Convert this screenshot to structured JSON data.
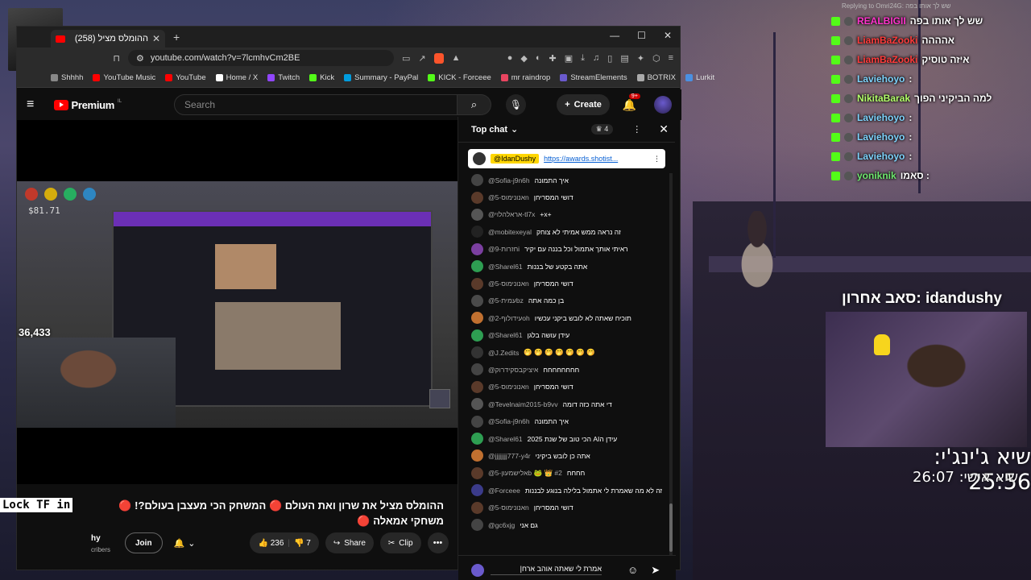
{
  "overlay": {
    "multiplier": "x4",
    "reply_to": "Replying to Omri24G: שש לך אותו בפה",
    "chat": [
      {
        "user": "REALBIGII",
        "user_color": "#ff33cc",
        "text": "שש לך אותו בפה",
        "badges": 3
      },
      {
        "user": "LiamBaZooki",
        "user_color": "#ff3b3b",
        "text": "אהההה"
      },
      {
        "user": "LiamBaZooki",
        "user_color": "#ff3b3b",
        "text": "איזה טוסיק"
      },
      {
        "user": "Laviehoyo",
        "user_color": "#7dd3fc",
        "text": ":"
      },
      {
        "user": "NikitaBarak",
        "user_color": "#b3ff6a",
        "text": "למה הביקיני הפוך"
      },
      {
        "user": "Laviehoyo",
        "user_color": "#7dd3fc",
        "text": ":"
      },
      {
        "user": "Laviehoyo",
        "user_color": "#7dd3fc",
        "text": ":"
      },
      {
        "user": "Laviehoyo",
        "user_color": "#7dd3fc",
        "text": ":"
      },
      {
        "user": "yoniknik",
        "user_color": "#6ee86e",
        "text": ": סאמו"
      }
    ],
    "cam_banner": "idandushy :סאב אחרון",
    "timer_main": "שיא ג'ינג'י: 25:56",
    "timer_personal": "שיא אישי: 26:07"
  },
  "browser": {
    "tab_title": "ההומלס מציל (258)",
    "url": "youtube.com/watch?v=7lcmhvCm2BE",
    "bookmarks": [
      {
        "label": "Shhhh",
        "color": "#888"
      },
      {
        "label": "YouTube Music",
        "color": "#ff0000"
      },
      {
        "label": "YouTube",
        "color": "#ff0000"
      },
      {
        "label": "Home / X",
        "color": "#ffffff"
      },
      {
        "label": "Twitch",
        "color": "#9146ff"
      },
      {
        "label": "Kick",
        "color": "#53fc18"
      },
      {
        "label": "Summary - PayPal",
        "color": "#009cde"
      },
      {
        "label": "KICK - Forceee",
        "color": "#53fc18"
      },
      {
        "label": "mr raindrop",
        "color": "#e94560"
      },
      {
        "label": "StreamElements",
        "color": "#6a5acd"
      },
      {
        "label": "BOTRIX",
        "color": "#aaaaaa"
      },
      {
        "label": "Lurkit",
        "color": "#4a90e2"
      }
    ]
  },
  "youtube": {
    "brand": "Premium",
    "brand_region": "IL",
    "search_placeholder": "Search",
    "create_label": "Create",
    "notif_count": "9+",
    "video_title": "ההומלס מציל את שרון ואת העולם 🔴 המשחק הכי מעצבן בעולם?! 🔴 משחקי אמאלה 🔴",
    "viewer_count": "36,433",
    "hud_money": "$81.71",
    "lock_label": "Lock TF in",
    "channel_name": "hy",
    "subscribers": "cribers",
    "join_label": "Join",
    "likes": "236",
    "dislikes": "7",
    "share_label": "Share",
    "clip_label": "Clip"
  },
  "chat": {
    "mode": "Top chat",
    "members_badge": "4",
    "pinned_author": "@IdanDushy",
    "pinned_link": "https://awards.shotist...",
    "messages": [
      {
        "author": "@Sofia-j9n6h",
        "text": "איך התמונה",
        "av": "#444"
      },
      {
        "author": "@אנונימוס-5n",
        "text": "דושי המסריחן",
        "av": "#5a3a2a"
      },
      {
        "author": "@אראלהלוי-tl7x",
        "text": "+x+",
        "av": "#555"
      },
      {
        "author": "@mobitexeyal",
        "text": "זה נראה ממש אמיתי לא צוחק",
        "av": "#222"
      },
      {
        "author": "@חזרות-9i",
        "text": "ראיתי אותך אתמול וכל בננה עם יקיר",
        "av": "#7b3fa0"
      },
      {
        "author": "@Sharel61",
        "text": "אתה בקטע של בננות",
        "av": "#2e9e52"
      },
      {
        "author": "@אנונימוס-5n",
        "text": "דושי המסריחן",
        "av": "#5a3a2a"
      },
      {
        "author": "@עמית-5bz",
        "text": "בן כמה אתה",
        "av": "#4a4a4a"
      },
      {
        "author": "@עידולוף-2oh",
        "text": "תוכיח שאתה לא לובש ביקני עכשיו",
        "av": "#c07030"
      },
      {
        "author": "@Sharel61",
        "text": "עידן עושה בלגן",
        "av": "#2e9e52"
      },
      {
        "author": "@J.Zedits",
        "text": "🤭 🤭 🤭 🤭 🤭 🤭 🤭",
        "av": "#333"
      },
      {
        "author": "@איציקבסקידרוק",
        "text": "חחחחחחחח",
        "av": "#444"
      },
      {
        "author": "@אנונימוס-5n",
        "text": "דושי המסריחן",
        "av": "#5a3a2a"
      },
      {
        "author": "@Tevelnaim2015-b9vv",
        "text": "די אתה כזה דומה",
        "av": "#555"
      },
      {
        "author": "@Sofia-j9n6h",
        "text": "איך התמונה",
        "av": "#444"
      },
      {
        "author": "@Sharel61",
        "text": "עידן הAI הכי טוב של שנת 2025",
        "av": "#2e9e52"
      },
      {
        "author": "@jjjjjjjj777-y4r",
        "text": "אתה כן לובש ביקיני",
        "av": "#c07030"
      },
      {
        "author": "@אלישמעון-5b 🐸 👑 #2",
        "text": "חחחח",
        "av": "#5a3a2a"
      },
      {
        "author": "@Forceee",
        "text": "זה לא מה שאמרת לי אתמול בלילה בנוגע לבננות",
        "av": "#3b3b8a"
      },
      {
        "author": "@אנונימוס-5n",
        "text": "דושי המסריחן",
        "av": "#5a3a2a"
      },
      {
        "author": "@gc6xjg",
        "text": "גם אני",
        "av": "#444"
      }
    ],
    "input_value": "אמרת לי שאתה אוהב ארח|"
  }
}
